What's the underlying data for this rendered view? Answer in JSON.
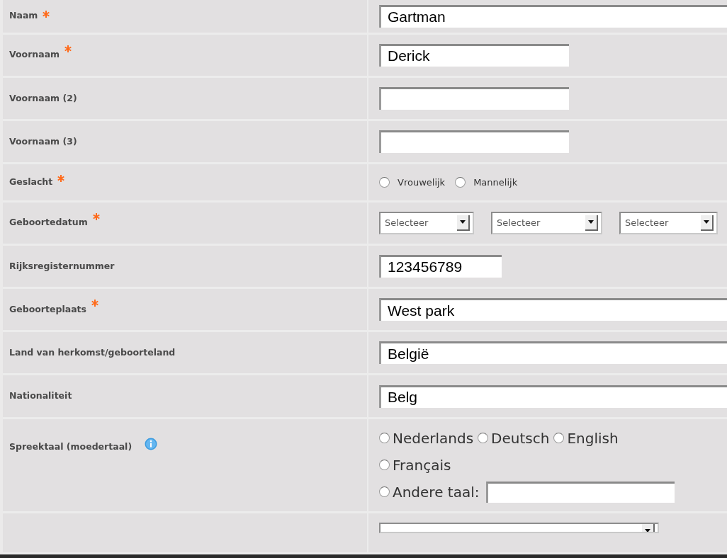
{
  "rows": [
    {
      "label": "Naam",
      "required": true,
      "kind": "wide_text",
      "value": "Gartman"
    },
    {
      "label": "Voornaam",
      "required": true,
      "kind": "text",
      "value": "Derick"
    },
    {
      "label": "Voornaam (2)",
      "required": false,
      "kind": "text"
    },
    {
      "label": "Voornaam (3)",
      "required": false,
      "kind": "text"
    },
    {
      "label": "Geslacht",
      "required": true,
      "kind": "radios",
      "options": [
        {
          "label": "Vrouwelijk",
          "checked": false
        },
        {
          "label": "Mannelijk",
          "checked": false
        }
      ]
    },
    {
      "label": "Geboortedatum",
      "required": true,
      "kind": "date",
      "selects": [
        "Selecteer",
        "Selecteer",
        "Selecteer"
      ]
    },
    {
      "label": "Rijksregisternummer",
      "required": false,
      "kind": "narrow_text",
      "value": "123456789"
    },
    {
      "label": "Geboorteplaats",
      "required": true,
      "kind": "wide_text",
      "value": "West park"
    },
    {
      "label": "Land van herkomst/geboorteland",
      "required": false,
      "kind": "wide_text",
      "value": "België"
    },
    {
      "label": "Nationaliteit",
      "required": false,
      "kind": "wide_text",
      "value": "Belg"
    },
    {
      "label": "Spreektaal (moedertaal)",
      "required": false,
      "info": true,
      "kind": "languages",
      "options": [
        {
          "label": "Nederlands",
          "checked": false
        },
        {
          "label": "Deutsch",
          "checked": false
        },
        {
          "label": "English",
          "checked": false
        },
        {
          "label": "Français",
          "checked": false
        }
      ],
      "other": {
        "label": "Andere taal:",
        "checked": false
      }
    },
    {
      "kind": "select"
    }
  ]
}
